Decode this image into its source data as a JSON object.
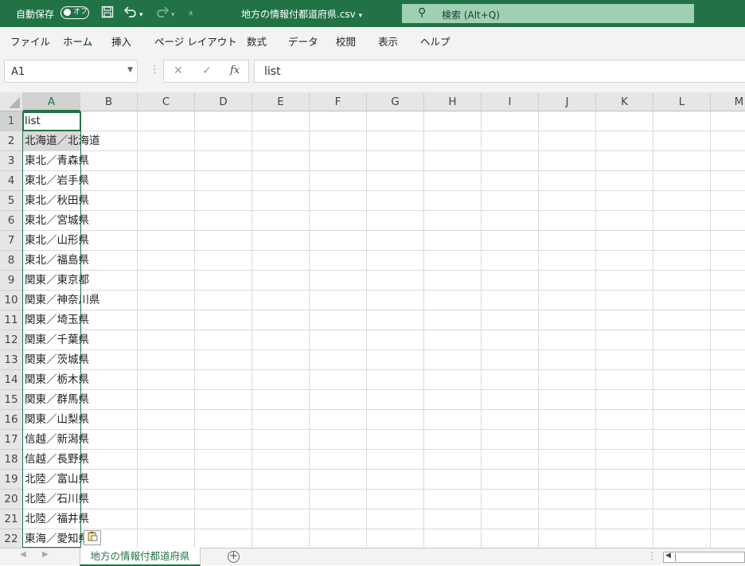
{
  "titlebar": {
    "autosave_label": "自動保存",
    "autosave_state": "オフ",
    "file_name": "地方の情報付都道府県.csv",
    "search_placeholder": "検索 (Alt+Q)",
    "accent_color": "#217346"
  },
  "menu": [
    "ファイル",
    "ホーム",
    "挿入",
    "ページ レイアウト",
    "数式",
    "データ",
    "校閲",
    "表示",
    "ヘルプ"
  ],
  "formula_bar": {
    "name_box": "A1",
    "cancel_symbol": "✕",
    "enter_symbol": "✓",
    "fx_symbol": "fx",
    "content": "list"
  },
  "columns": [
    "A",
    "B",
    "C",
    "D",
    "E",
    "F",
    "G",
    "H",
    "I",
    "J",
    "K",
    "L",
    "M"
  ],
  "rows": [
    "1",
    "2",
    "3",
    "4",
    "5",
    "6",
    "7",
    "8",
    "9",
    "10",
    "11",
    "12",
    "13",
    "14",
    "15",
    "16",
    "17",
    "18",
    "19",
    "20",
    "21",
    "22"
  ],
  "cells_A": [
    "list",
    "北海道／北海道",
    "東北／青森県",
    "東北／岩手県",
    "東北／秋田県",
    "東北／宮城県",
    "東北／山形県",
    "東北／福島県",
    "関東／東京都",
    "関東／神奈川県",
    "関東／埼玉県",
    "関東／千葉県",
    "関東／茨城県",
    "関東／栃木県",
    "関東／群馬県",
    "関東／山梨県",
    "信越／新潟県",
    "信越／長野県",
    "北陸／富山県",
    "北陸／石川県",
    "北陸／福井県",
    "東海／愛知県"
  ],
  "sheet_tab": "地方の情報付都道府県",
  "icons": {
    "save": "save-icon",
    "undo": "undo-icon",
    "redo": "redo-icon",
    "search": "search-icon",
    "paste_options": "paste-options-icon",
    "add_sheet": "add-sheet-icon"
  }
}
